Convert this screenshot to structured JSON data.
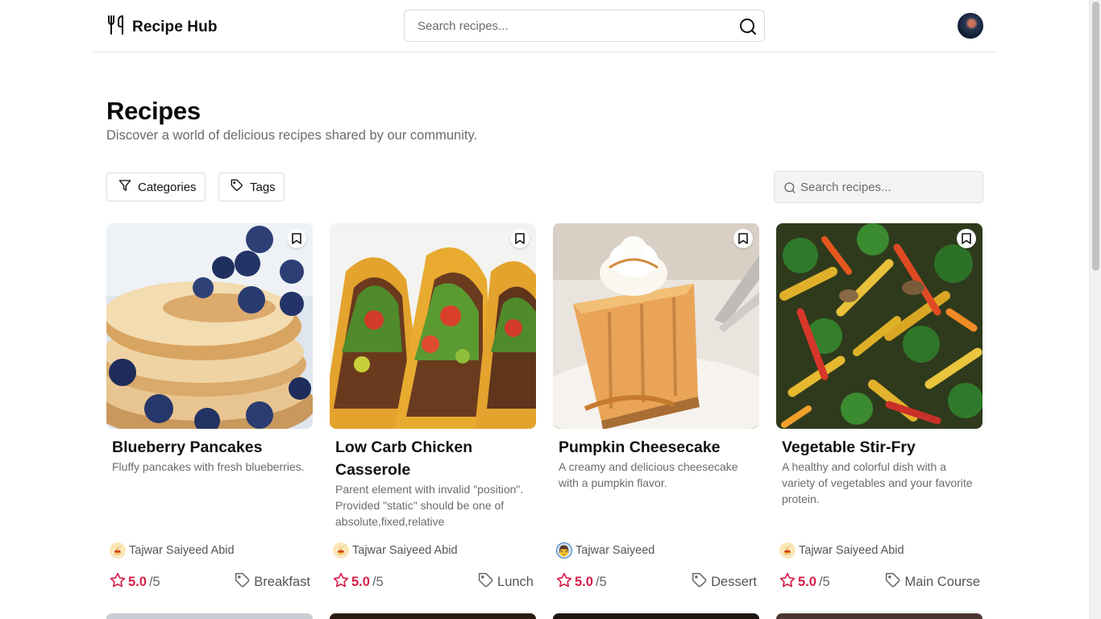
{
  "app": {
    "name": "Recipe Hub",
    "search_placeholder": "Search recipes..."
  },
  "page": {
    "title": "Recipes",
    "subtitle": "Discover a world of delicious recipes shared by our community."
  },
  "filters": {
    "categories_label": "Categories",
    "tags_label": "Tags",
    "search_placeholder": "Search recipes..."
  },
  "recipes": [
    {
      "title": "Blueberry Pancakes",
      "description": "Fluffy pancakes with fresh blueberries.",
      "author": "Tajwar Saiyeed Abid",
      "rating": "5.0",
      "rating_max": "/5",
      "category": "Breakfast"
    },
    {
      "title": "Low Carb Chicken Casserole",
      "description": "Parent element with invalid \"position\". Provided \"static\" should be one of absolute,fixed,relative",
      "author": "Tajwar Saiyeed Abid",
      "rating": "5.0",
      "rating_max": "/5",
      "category": "Lunch"
    },
    {
      "title": "Pumpkin Cheesecake",
      "description": "A creamy and delicious cheesecake with a pumpkin flavor.",
      "author": "Tajwar Saiyeed",
      "rating": "5.0",
      "rating_max": "/5",
      "category": "Dessert"
    },
    {
      "title": "Vegetable Stir-Fry",
      "description": "A healthy and colorful dish with a variety of vegetables and your favorite protein.",
      "author": "Tajwar Saiyeed Abid",
      "rating": "5.0",
      "rating_max": "/5",
      "category": "Main Course"
    }
  ],
  "colors": {
    "accent": "#d61f4a",
    "muted_text": "#6b6b6b",
    "border": "#d9d9d9"
  },
  "icons": {
    "brand": "utensils-icon",
    "search": "search-icon",
    "filter": "filter-icon",
    "tag": "tag-icon",
    "bookmark": "bookmark-icon",
    "star": "star-icon"
  }
}
